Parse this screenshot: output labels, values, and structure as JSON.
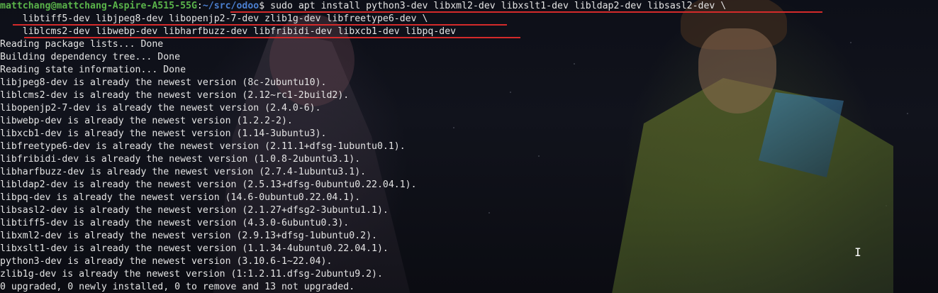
{
  "prompt": {
    "user_host": "mattchang@mattchang-Aspire-A515-55G",
    "colon": ":",
    "path": "~/src/odoo",
    "symbol": "$",
    "command": " sudo apt install python3-dev libxml2-dev libxslt1-dev libldap2-dev libsasl2-dev \\"
  },
  "command_continuation": [
    "    libtiff5-dev libjpeg8-dev libopenjp2-7-dev zlib1g-dev libfreetype6-dev \\",
    "    liblcms2-dev libwebp-dev libharfbuzz-dev libfribidi-dev libxcb1-dev libpq-dev"
  ],
  "output_lines": [
    "Reading package lists... Done",
    "Building dependency tree... Done",
    "Reading state information... Done",
    "libjpeg8-dev is already the newest version (8c-2ubuntu10).",
    "liblcms2-dev is already the newest version (2.12~rc1-2build2).",
    "libopenjp2-7-dev is already the newest version (2.4.0-6).",
    "libwebp-dev is already the newest version (1.2.2-2).",
    "libxcb1-dev is already the newest version (1.14-3ubuntu3).",
    "libfreetype6-dev is already the newest version (2.11.1+dfsg-1ubuntu0.1).",
    "libfribidi-dev is already the newest version (1.0.8-2ubuntu3.1).",
    "libharfbuzz-dev is already the newest version (2.7.4-1ubuntu3.1).",
    "libldap2-dev is already the newest version (2.5.13+dfsg-0ubuntu0.22.04.1).",
    "libpq-dev is already the newest version (14.6-0ubuntu0.22.04.1).",
    "libsasl2-dev is already the newest version (2.1.27+dfsg2-3ubuntu1.1).",
    "libtiff5-dev is already the newest version (4.3.0-6ubuntu0.3).",
    "libxml2-dev is already the newest version (2.9.13+dfsg-1ubuntu0.2).",
    "libxslt1-dev is already the newest version (1.1.34-4ubuntu0.22.04.1).",
    "python3-dev is already the newest version (3.10.6-1~22.04).",
    "zlib1g-dev is already the newest version (1:1.2.11.dfsg-2ubuntu9.2).",
    "0 upgraded, 0 newly installed, 0 to remove and 13 not upgraded."
  ],
  "colors": {
    "prompt_user": "#5ab34a",
    "prompt_path": "#4b7fd0",
    "text": "#e4e4e4",
    "annotation_underline": "#d42a2a"
  },
  "icons": {
    "mouse_cursor": "text-ibeam-cursor-icon"
  }
}
